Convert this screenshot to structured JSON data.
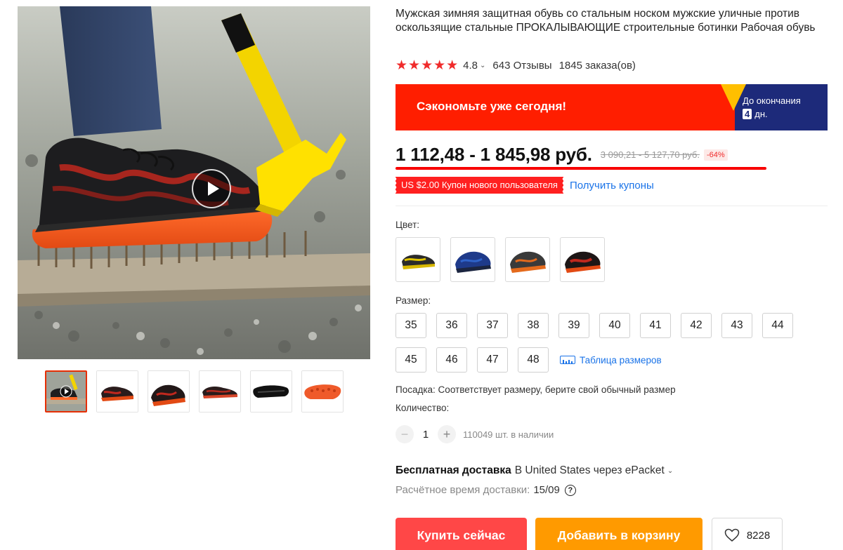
{
  "product": {
    "title": "Мужская зимняя защитная обувь со стальным носком мужские уличные против оскользящие стальные ПРОКАЛЫВАЮЩИЕ строительные ботинки Рабочая обувь",
    "rating": "4.8",
    "reviews": "643 Отзывы",
    "orders": "1845 заказа(ов)",
    "stars_count": 5
  },
  "promo": {
    "headline": "Сэкономьте уже сегодня!",
    "until_label": "До окончания",
    "days_number": "4",
    "days_unit": "дн.",
    "color_bg": "#ff1e00",
    "color_dark": "#1d2a7a"
  },
  "price": {
    "current": "1 112,48 - 1 845,98 руб.",
    "original": "3 090,21 - 5 127,70 руб.",
    "discount": "-64%"
  },
  "coupon": {
    "tag": "US $2.00 Купон нового пользователя",
    "link": "Получить купоны"
  },
  "color_section": {
    "label": "Цвет:",
    "options": [
      "black-yellow",
      "blue",
      "grey-orange",
      "black-red"
    ]
  },
  "size_section": {
    "label": "Размер:",
    "row1": [
      "35",
      "36",
      "37",
      "38",
      "39",
      "40",
      "41",
      "42",
      "43",
      "44"
    ],
    "row2": [
      "45",
      "46",
      "47",
      "48"
    ],
    "chart_link": "Таблица размеров"
  },
  "fit_text": "Посадка: Соответствует размеру, берите свой обычный размер",
  "quantity": {
    "label": "Количество:",
    "value": "1",
    "minus": "−",
    "plus": "+",
    "stock": "110049 шт. в наличии"
  },
  "shipping": {
    "free": "Бесплатная доставка",
    "destination": "В United States через ePacket",
    "eta_label": "Расчётное время доставки:",
    "eta_date": "15/09",
    "help": "?"
  },
  "actions": {
    "buy_now": "Купить сейчас",
    "add_to_cart": "Добавить в корзину",
    "wishlist_count": "8228"
  },
  "gallery": {
    "thumbnails": [
      "video-thumb",
      "shoe-side",
      "shoe-angle",
      "shoe-lateral",
      "shoe-bottom-black",
      "shoe-sole-orange"
    ]
  }
}
